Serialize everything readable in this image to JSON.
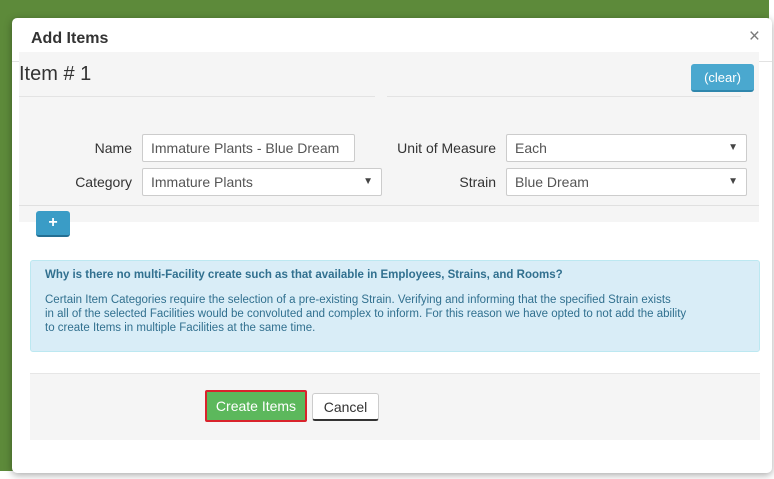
{
  "modal": {
    "title": "Add Items",
    "close_glyph": "×"
  },
  "item": {
    "heading": "Item # 1",
    "clear_label": "(clear)",
    "fields": {
      "name_label": "Name",
      "name_value": "Immature Plants - Blue Dream",
      "uom_label": "Unit of Measure",
      "uom_value": "Each",
      "category_label": "Category",
      "category_value": "Immature Plants",
      "strain_label": "Strain",
      "strain_value": "Blue Dream"
    },
    "add_glyph": "+"
  },
  "info": {
    "title": "Why is there no multi-Facility create such as that available in Employees, Strains, and Rooms?",
    "line1": "Certain Item Categories require the selection of a pre-existing Strain. Verifying and informing that the specified Strain exists",
    "line2": "in all of the selected Facilities would be convoluted and complex to inform. For this reason we have opted to not add the ability",
    "line3": "to create Items in multiple Facilities at the same time."
  },
  "footer": {
    "create_label": "Create Items",
    "cancel_label": "Cancel"
  },
  "icons": {
    "caret": "▼",
    "close": "close-icon",
    "plus": "plus-icon"
  },
  "colors": {
    "backdrop": "#5d8a3a",
    "primary_info": "#4aa8cf",
    "success": "#5cb85c",
    "highlight_border": "#d9232c",
    "info_bg": "#d9edf7",
    "info_text": "#31708f"
  }
}
